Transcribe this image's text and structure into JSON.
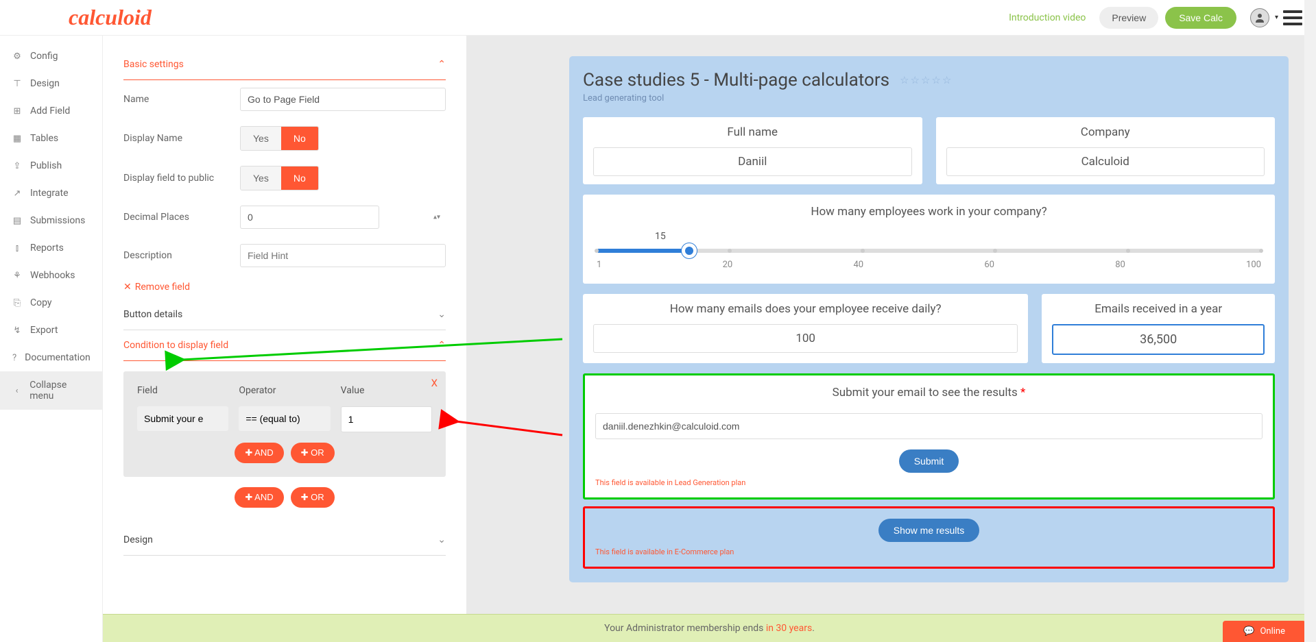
{
  "header": {
    "logo": "calculoid",
    "intro_link": "Introduction video",
    "preview": "Preview",
    "save": "Save Calc"
  },
  "sidebar": {
    "items": [
      {
        "icon": "⚙",
        "label": "Config"
      },
      {
        "icon": "⊤",
        "label": "Design"
      },
      {
        "icon": "⊞",
        "label": "Add Field"
      },
      {
        "icon": "▦",
        "label": "Tables"
      },
      {
        "icon": "⇪",
        "label": "Publish"
      },
      {
        "icon": "↗",
        "label": "Integrate"
      },
      {
        "icon": "▤",
        "label": "Submissions"
      },
      {
        "icon": "⫾",
        "label": "Reports"
      },
      {
        "icon": "⚘",
        "label": "Webhooks"
      },
      {
        "icon": "⎘",
        "label": "Copy"
      },
      {
        "icon": "↯",
        "label": "Export"
      },
      {
        "icon": "?",
        "label": "Documentation"
      },
      {
        "icon": "‹",
        "label": "Collapse menu"
      }
    ]
  },
  "settings": {
    "basic_title": "Basic settings",
    "name_label": "Name",
    "name_value": "Go to Page Field",
    "display_name_label": "Display Name",
    "display_public_label": "Display field to public",
    "decimal_label": "Decimal Places",
    "decimal_value": "0",
    "description_label": "Description",
    "description_placeholder": "Field Hint",
    "yes": "Yes",
    "no": "No",
    "remove": "Remove field",
    "button_details": "Button details",
    "condition_title": "Condition to display field",
    "design_title": "Design",
    "condition": {
      "field_label": "Field",
      "operator_label": "Operator",
      "value_label": "Value",
      "field_value": "Submit your e",
      "operator_value": "== (equal to)",
      "value_value": "1",
      "close": "X",
      "and": "AND",
      "or": "OR"
    }
  },
  "preview": {
    "title": "Case studies 5 - Multi-page calculators",
    "subtitle": "Lead generating tool",
    "full_name_label": "Full name",
    "full_name_value": "Daniil",
    "company_label": "Company",
    "company_value": "Calculoid",
    "employees_label": "How many employees work in your company?",
    "slider_value": "15",
    "slider_ticks": [
      "1",
      "20",
      "40",
      "60",
      "80",
      "100"
    ],
    "emails_daily_label": "How many emails does your employee receive daily?",
    "emails_daily_value": "100",
    "emails_year_label": "Emails received in a year",
    "emails_year_value": "36,500",
    "submit_label": "Submit your email to see the results",
    "email_value": "daniil.denezhkin@calculoid.com",
    "submit_btn": "Submit",
    "lead_gen_note": "This field is available in Lead Generation plan",
    "show_results": "Show me results",
    "ecommerce_note": "This field is available in E-Commerce plan"
  },
  "footer": {
    "text_prefix": "Your Administrator membership ends ",
    "text_highlight": "in 30 years",
    "text_suffix": "."
  },
  "chat": {
    "label": "Online"
  }
}
